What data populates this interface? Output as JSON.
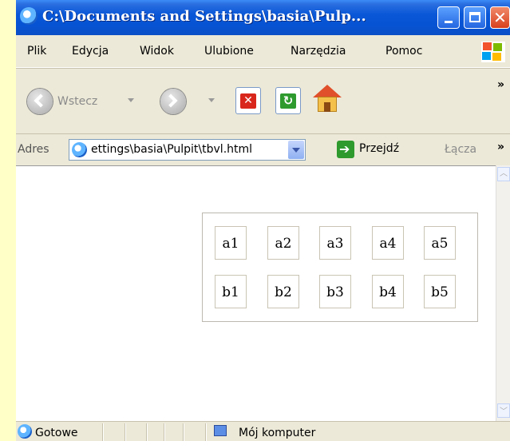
{
  "window": {
    "title": "C:\\Documents and Settings\\basia\\Pulp...",
    "close_glyph": "✕"
  },
  "menu": {
    "items": [
      "Plik",
      "Edycja",
      "Widok",
      "Ulubione",
      "Narzędzia",
      "Pomoc"
    ]
  },
  "toolbar": {
    "back_label": "Wstecz",
    "overflow": "»"
  },
  "address": {
    "label": "Adres",
    "url": "ettings\\basia\\Pulpit\\tbvl.html",
    "go_label": "Przejdź",
    "links_label": "Łącza",
    "overflow": "»"
  },
  "table": {
    "rows": [
      [
        "a1",
        "a2",
        "a3",
        "a4",
        "a5"
      ],
      [
        "b1",
        "b2",
        "b3",
        "b4",
        "b5"
      ]
    ]
  },
  "status": {
    "text": "Gotowe",
    "zone": "Mój komputer"
  }
}
